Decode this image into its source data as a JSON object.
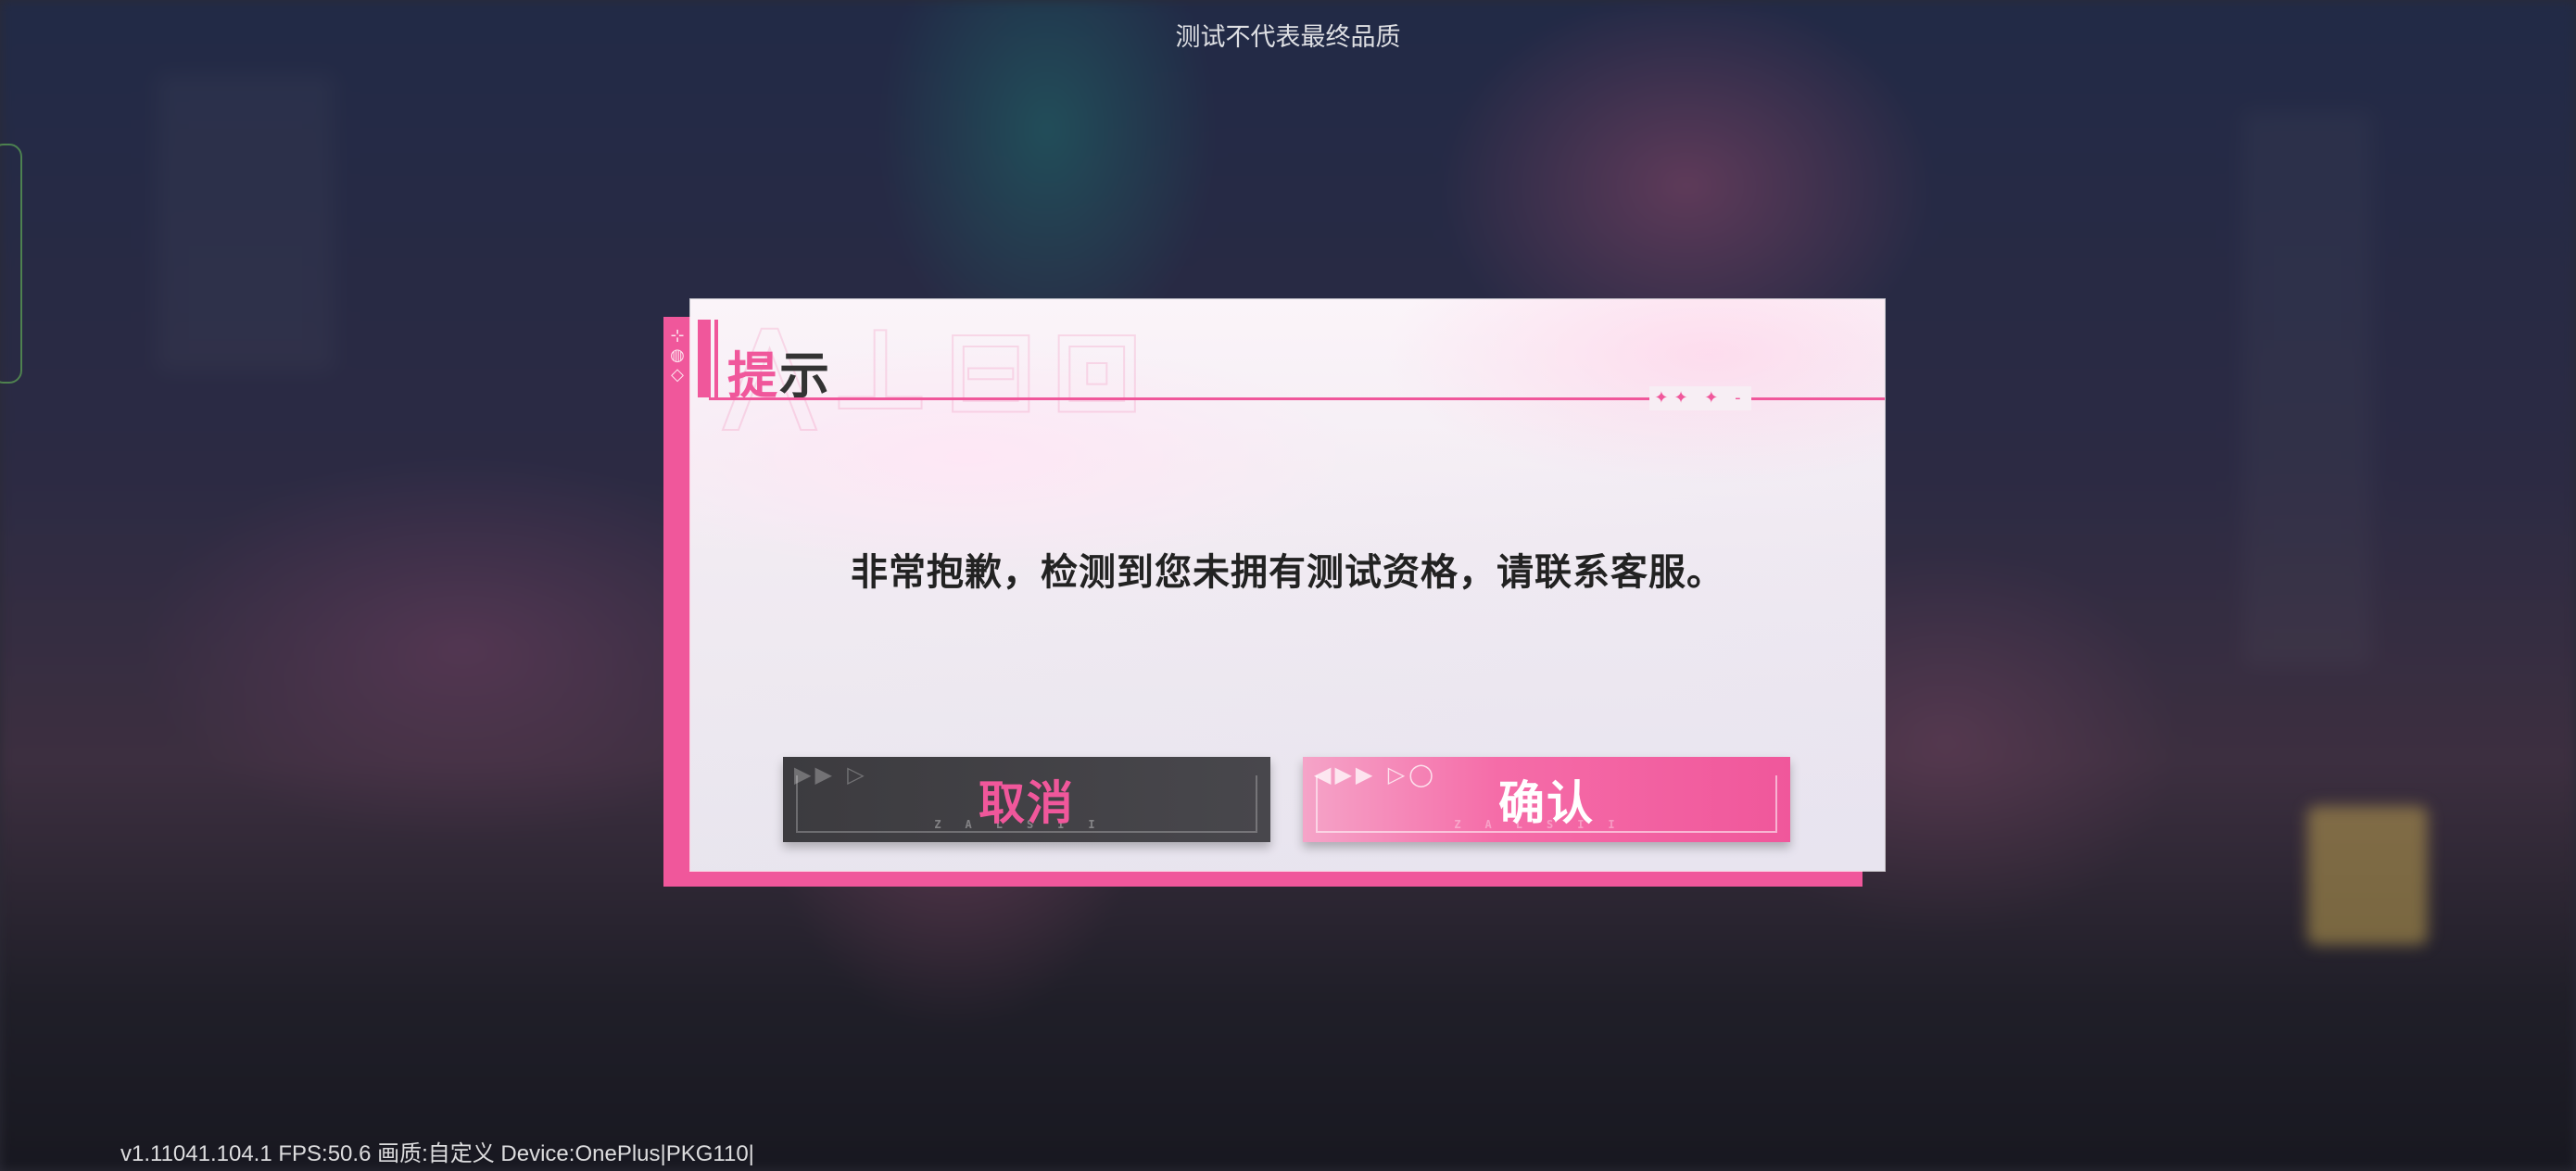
{
  "watermark": "测试不代表最终品质",
  "version_info": "v1.11041.104.1 FPS:50.6 画质:自定义 Device:OnePlus|PKG110|",
  "dialog": {
    "title_first_char": "提",
    "title_rest": "示",
    "message": "非常抱歉，检测到您未拥有测试资格，请联系客服。",
    "cancel_label": "取消",
    "confirm_label": "确认"
  },
  "colors": {
    "accent": "#f0579b",
    "cancel_bg": "#3c3b3f",
    "text_dark": "#222222"
  },
  "icons": [
    "title-accent-bar",
    "arrow-deco-icon"
  ]
}
